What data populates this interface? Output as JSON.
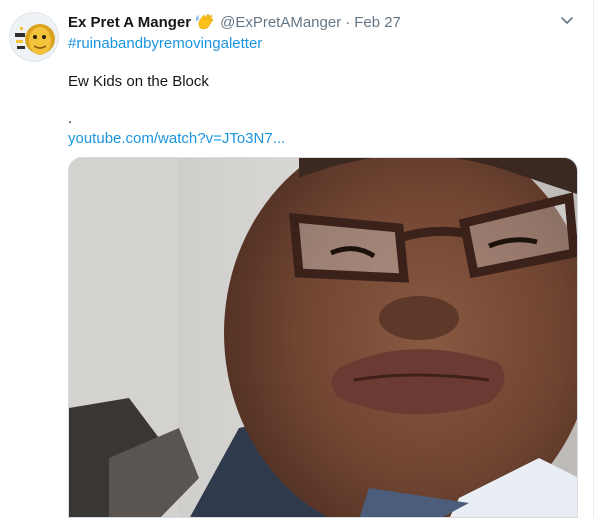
{
  "tweet": {
    "display_name": "Ex Pret A Manger",
    "handle": "@ExPretAManger",
    "separator": "·",
    "date": "Feb 27",
    "hashtag": "#ruinabandbyremovingaletter",
    "text": "Ew Kids on the Block",
    "dot": ".",
    "link_text": "youtube.com/watch?v=JTo3N7..."
  },
  "icons": {
    "avatar": "avatar-image",
    "emoji": "waving-hand-icon",
    "menu": "chevron-down-icon"
  },
  "colors": {
    "link": "#1b95e0",
    "muted": "#657786",
    "text": "#14171a"
  }
}
